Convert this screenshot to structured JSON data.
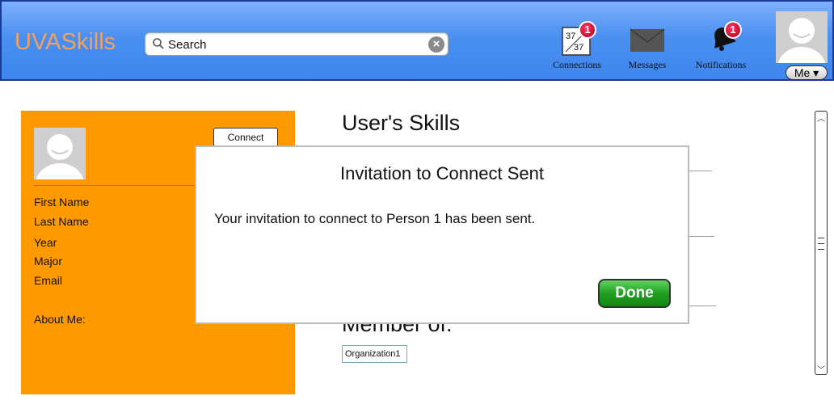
{
  "header": {
    "brand": "UVASkills",
    "search_placeholder": "Search",
    "nav": {
      "connections": {
        "label": "Connections",
        "badge": "1",
        "icon_text_top": "37",
        "icon_text_bottom": "37"
      },
      "messages": {
        "label": "Messages"
      },
      "notifications": {
        "label": "Notifications",
        "badge": "1"
      }
    },
    "me_label": "Me ▾"
  },
  "profile": {
    "connect_label": "Connect",
    "fields": {
      "first_name": "First Name",
      "last_name": "Last Name",
      "year": "Year",
      "major": "Major",
      "email": "Email",
      "about": "About Me:"
    }
  },
  "main": {
    "skills_title": "User's Skills",
    "member_title": "Member of:",
    "organizations": [
      "Organization1"
    ]
  },
  "dialog": {
    "title": "Invitation to Connect Sent",
    "message": "Your invitation to connect to Person 1 has been sent.",
    "done_label": "Done"
  },
  "colors": {
    "header_blue": "#4a90f0",
    "brand_orange": "#f0a060",
    "profile_orange": "#ff9900",
    "badge_red": "#c8102e",
    "done_green": "#22a022"
  }
}
